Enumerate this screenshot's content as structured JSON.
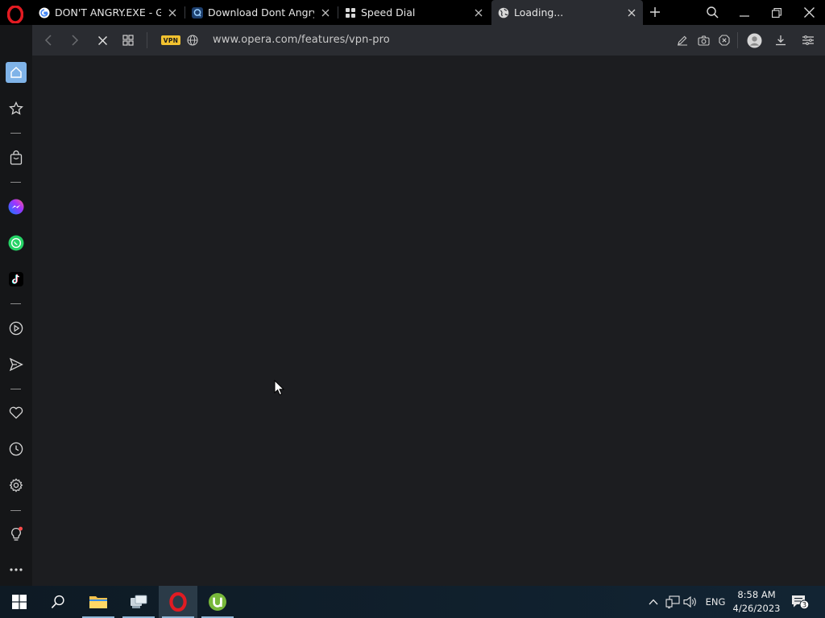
{
  "browser": {
    "tabs": [
      {
        "title": "DON'T ANGRY.EXE - Goo",
        "icon": "google-icon",
        "active": false
      },
      {
        "title": "Download Dont Angry! by",
        "icon": "site-q-icon",
        "active": false
      },
      {
        "title": "Speed Dial",
        "icon": "speed-dial-icon",
        "active": false
      },
      {
        "title": "Loading...",
        "icon": "globe-icon",
        "active": true
      }
    ],
    "address": {
      "vpn_label": "VPN",
      "url": "www.opera.com/features/vpn-pro"
    }
  },
  "sidebar": {
    "items": [
      "home-icon",
      "bookmarks-star-icon",
      "shopping-bag-icon",
      "messenger-icon",
      "whatsapp-icon",
      "tiktok-icon",
      "player-icon",
      "send-icon",
      "heart-icon",
      "history-clock-icon",
      "settings-gear-icon",
      "tips-bulb-icon",
      "more-dots-icon"
    ]
  },
  "taskbar": {
    "language": "ENG",
    "time": "8:58 AM",
    "date": "4/26/2023",
    "notification_count": "3"
  },
  "colors": {
    "tabstrip_bg": "#000000",
    "toolbar_bg": "#2a2c31",
    "content_bg": "#1c1d20",
    "vpn_badge": "#f2c230",
    "opera_red": "#e11b22"
  }
}
